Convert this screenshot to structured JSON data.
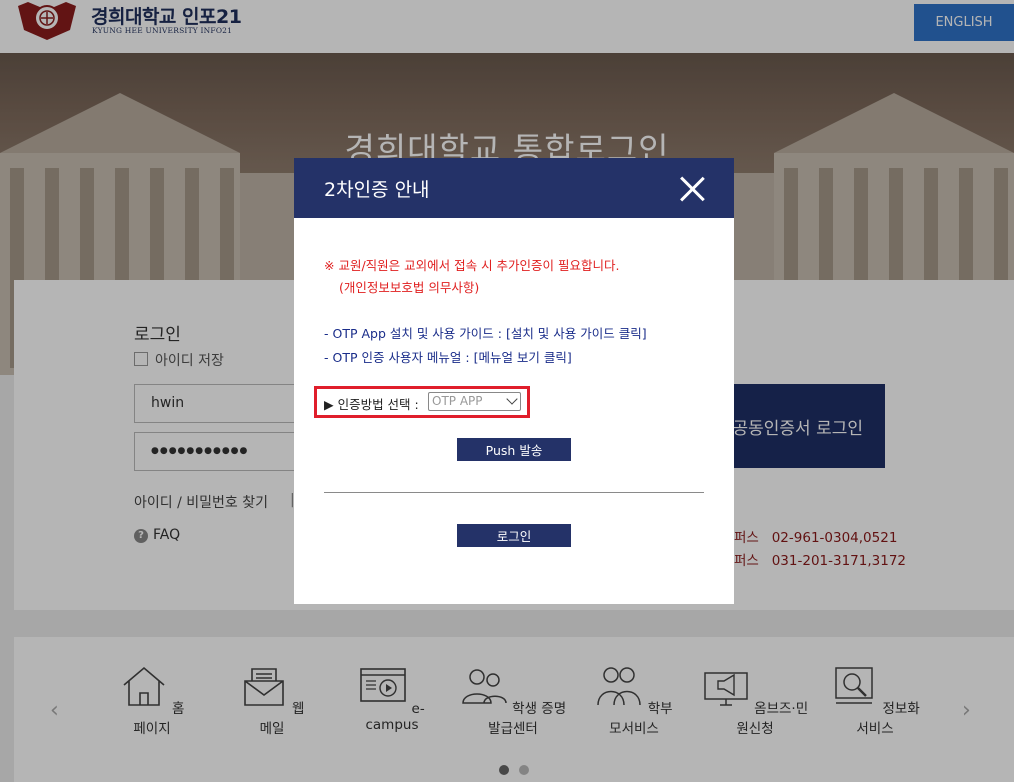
{
  "header": {
    "logo_title": "경희대학교 인포21",
    "logo_subtitle": "KYUNG HEE UNIVERSITY INFO21",
    "english_button": "ENGLISH"
  },
  "hero": {
    "title": "경희대학교 통합로그인"
  },
  "login": {
    "label": "로그인",
    "remember_label": "아이디 저장",
    "id_value": "hwin",
    "password_value": "●●●●●●●●●●●",
    "find_link": "아이디 / 비밀번호 찾기",
    "separator": "|",
    "faq": "FAQ",
    "cert_login_button": "공동인증서 로그인",
    "contact_lines": [
      "퍼스   02-961-0304,0521",
      "퍼스   031-201-3171,3172"
    ]
  },
  "quick_menu": {
    "items": [
      {
        "label": "홈페이지",
        "icon": "house-icon"
      },
      {
        "label": "웹메일",
        "icon": "envelope-icon"
      },
      {
        "label": "e-campus",
        "icon": "video-player-icon"
      },
      {
        "label": "학생 증명발급센터",
        "icon": "people-icon"
      },
      {
        "label": "학부모서비스",
        "icon": "parents-icon"
      },
      {
        "label": "옴브즈·민원신청",
        "icon": "megaphone-monitor-icon"
      },
      {
        "label": "정보화서비스",
        "icon": "magnifier-monitor-icon"
      }
    ],
    "prev_arrow": "‹",
    "next_arrow": "›"
  },
  "modal": {
    "title": "2차인증 안내",
    "notice_line1": "※ 교원/직원은 교외에서 접속 시 추가인증이 필요합니다.",
    "notice_line2": "(개인정보보호법 의무사항)",
    "guide1_text": "- OTP App 설치 및 사용 가이드 : ",
    "guide1_link": "[설치 및 사용 가이드 클릭]",
    "guide2_text": "- OTP 인증 사용자 메뉴얼 : ",
    "guide2_link": "[메뉴얼 보기 클릭]",
    "method_label": "▶ 인증방법 선택 :",
    "method_selected": "OTP APP",
    "push_button": "Push 발송",
    "login_button": "로그인"
  },
  "colors": {
    "modal_header": "#243268",
    "notice_red": "#e02020",
    "guide_blue": "#1a2d8a",
    "highlight_border": "#e01e2b",
    "english_button": "#2f72c8"
  }
}
